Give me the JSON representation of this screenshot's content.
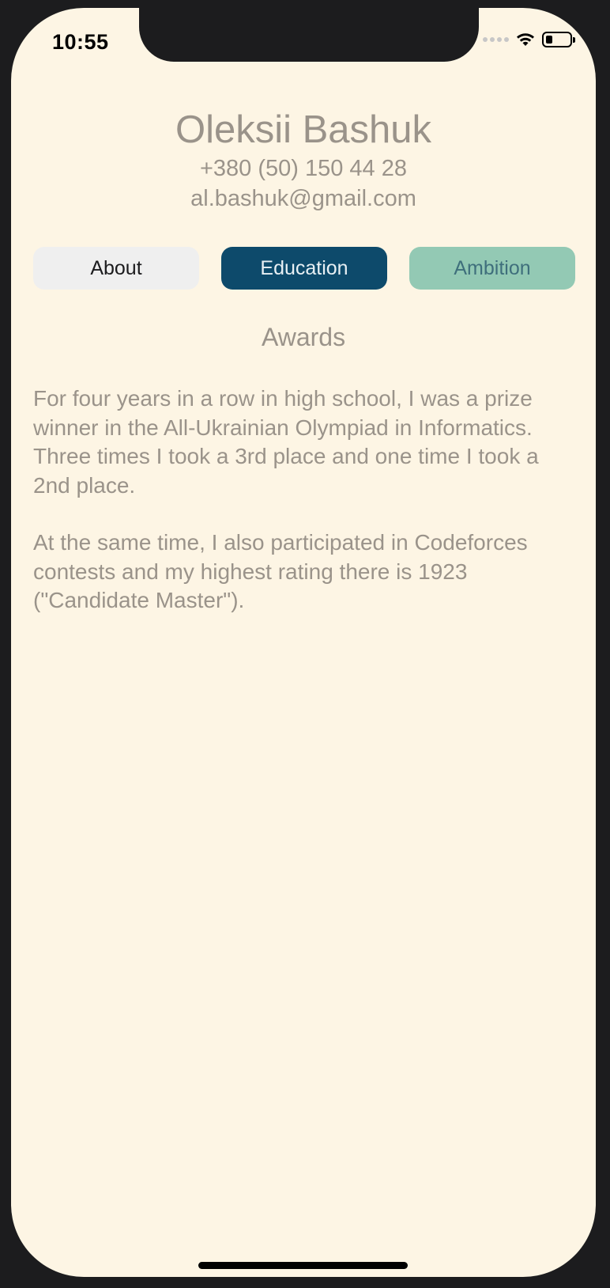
{
  "status_bar": {
    "time": "10:55"
  },
  "profile": {
    "name": "Oleksii Bashuk",
    "phone": "+380 (50) 150 44 28",
    "email": "al.bashuk@gmail.com"
  },
  "tabs": [
    {
      "label": "About",
      "selected": false
    },
    {
      "label": "Education",
      "selected": true
    },
    {
      "label": "Ambition",
      "selected": false
    }
  ],
  "section": {
    "title": "Awards",
    "paragraphs": [
      "For four years in a row in high school, I was a prize winner in the All-Ukrainian Olympiad in Informatics. Three times I took a 3rd place and one time I took a 2nd place.",
      "At the same time, I also participated in Codeforces contests and my highest rating there is 1923 (\"Candidate Master\")."
    ]
  },
  "colors": {
    "background": "#fdf5e4",
    "text": "#9a938a",
    "tab_about_bg": "#efefef",
    "tab_education_bg": "#0d4a6b",
    "tab_ambition_bg": "#93c9b4"
  },
  "icons": [
    "signal-icon",
    "wifi-icon",
    "battery-icon"
  ]
}
